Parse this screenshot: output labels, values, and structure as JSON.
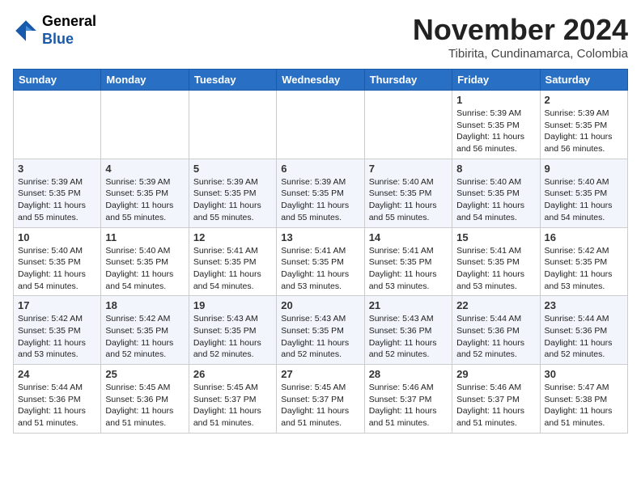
{
  "header": {
    "logo_general": "General",
    "logo_blue": "Blue",
    "month_year": "November 2024",
    "location": "Tibirita, Cundinamarca, Colombia"
  },
  "weekdays": [
    "Sunday",
    "Monday",
    "Tuesday",
    "Wednesday",
    "Thursday",
    "Friday",
    "Saturday"
  ],
  "weeks": [
    [
      {
        "day": "",
        "info": ""
      },
      {
        "day": "",
        "info": ""
      },
      {
        "day": "",
        "info": ""
      },
      {
        "day": "",
        "info": ""
      },
      {
        "day": "",
        "info": ""
      },
      {
        "day": "1",
        "info": "Sunrise: 5:39 AM\nSunset: 5:35 PM\nDaylight: 11 hours and 56 minutes."
      },
      {
        "day": "2",
        "info": "Sunrise: 5:39 AM\nSunset: 5:35 PM\nDaylight: 11 hours and 56 minutes."
      }
    ],
    [
      {
        "day": "3",
        "info": "Sunrise: 5:39 AM\nSunset: 5:35 PM\nDaylight: 11 hours and 55 minutes."
      },
      {
        "day": "4",
        "info": "Sunrise: 5:39 AM\nSunset: 5:35 PM\nDaylight: 11 hours and 55 minutes."
      },
      {
        "day": "5",
        "info": "Sunrise: 5:39 AM\nSunset: 5:35 PM\nDaylight: 11 hours and 55 minutes."
      },
      {
        "day": "6",
        "info": "Sunrise: 5:39 AM\nSunset: 5:35 PM\nDaylight: 11 hours and 55 minutes."
      },
      {
        "day": "7",
        "info": "Sunrise: 5:40 AM\nSunset: 5:35 PM\nDaylight: 11 hours and 55 minutes."
      },
      {
        "day": "8",
        "info": "Sunrise: 5:40 AM\nSunset: 5:35 PM\nDaylight: 11 hours and 54 minutes."
      },
      {
        "day": "9",
        "info": "Sunrise: 5:40 AM\nSunset: 5:35 PM\nDaylight: 11 hours and 54 minutes."
      }
    ],
    [
      {
        "day": "10",
        "info": "Sunrise: 5:40 AM\nSunset: 5:35 PM\nDaylight: 11 hours and 54 minutes."
      },
      {
        "day": "11",
        "info": "Sunrise: 5:40 AM\nSunset: 5:35 PM\nDaylight: 11 hours and 54 minutes."
      },
      {
        "day": "12",
        "info": "Sunrise: 5:41 AM\nSunset: 5:35 PM\nDaylight: 11 hours and 54 minutes."
      },
      {
        "day": "13",
        "info": "Sunrise: 5:41 AM\nSunset: 5:35 PM\nDaylight: 11 hours and 53 minutes."
      },
      {
        "day": "14",
        "info": "Sunrise: 5:41 AM\nSunset: 5:35 PM\nDaylight: 11 hours and 53 minutes."
      },
      {
        "day": "15",
        "info": "Sunrise: 5:41 AM\nSunset: 5:35 PM\nDaylight: 11 hours and 53 minutes."
      },
      {
        "day": "16",
        "info": "Sunrise: 5:42 AM\nSunset: 5:35 PM\nDaylight: 11 hours and 53 minutes."
      }
    ],
    [
      {
        "day": "17",
        "info": "Sunrise: 5:42 AM\nSunset: 5:35 PM\nDaylight: 11 hours and 53 minutes."
      },
      {
        "day": "18",
        "info": "Sunrise: 5:42 AM\nSunset: 5:35 PM\nDaylight: 11 hours and 52 minutes."
      },
      {
        "day": "19",
        "info": "Sunrise: 5:43 AM\nSunset: 5:35 PM\nDaylight: 11 hours and 52 minutes."
      },
      {
        "day": "20",
        "info": "Sunrise: 5:43 AM\nSunset: 5:35 PM\nDaylight: 11 hours and 52 minutes."
      },
      {
        "day": "21",
        "info": "Sunrise: 5:43 AM\nSunset: 5:36 PM\nDaylight: 11 hours and 52 minutes."
      },
      {
        "day": "22",
        "info": "Sunrise: 5:44 AM\nSunset: 5:36 PM\nDaylight: 11 hours and 52 minutes."
      },
      {
        "day": "23",
        "info": "Sunrise: 5:44 AM\nSunset: 5:36 PM\nDaylight: 11 hours and 52 minutes."
      }
    ],
    [
      {
        "day": "24",
        "info": "Sunrise: 5:44 AM\nSunset: 5:36 PM\nDaylight: 11 hours and 51 minutes."
      },
      {
        "day": "25",
        "info": "Sunrise: 5:45 AM\nSunset: 5:36 PM\nDaylight: 11 hours and 51 minutes."
      },
      {
        "day": "26",
        "info": "Sunrise: 5:45 AM\nSunset: 5:37 PM\nDaylight: 11 hours and 51 minutes."
      },
      {
        "day": "27",
        "info": "Sunrise: 5:45 AM\nSunset: 5:37 PM\nDaylight: 11 hours and 51 minutes."
      },
      {
        "day": "28",
        "info": "Sunrise: 5:46 AM\nSunset: 5:37 PM\nDaylight: 11 hours and 51 minutes."
      },
      {
        "day": "29",
        "info": "Sunrise: 5:46 AM\nSunset: 5:37 PM\nDaylight: 11 hours and 51 minutes."
      },
      {
        "day": "30",
        "info": "Sunrise: 5:47 AM\nSunset: 5:38 PM\nDaylight: 11 hours and 51 minutes."
      }
    ]
  ]
}
